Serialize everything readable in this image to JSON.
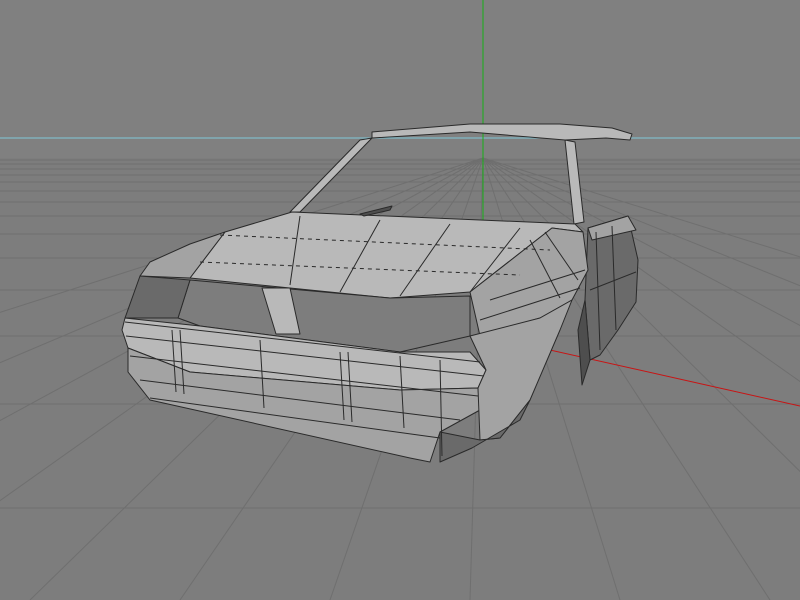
{
  "viewport": {
    "background_color": "#7f7f7f",
    "sky_color": "#808080",
    "ground_color": "#7d7d7d",
    "grid_color": "#6f6f6f",
    "horizon_color": "#7fc8d8",
    "axis_x_color": "#c81414",
    "axis_y_color": "#16b016"
  },
  "model": {
    "body_light": "#b9b9b9",
    "body_mid": "#a3a3a3",
    "body_dark": "#6a6a6a",
    "body_shadow": "#4e4e4e",
    "wire_color": "#2a2a2a"
  }
}
